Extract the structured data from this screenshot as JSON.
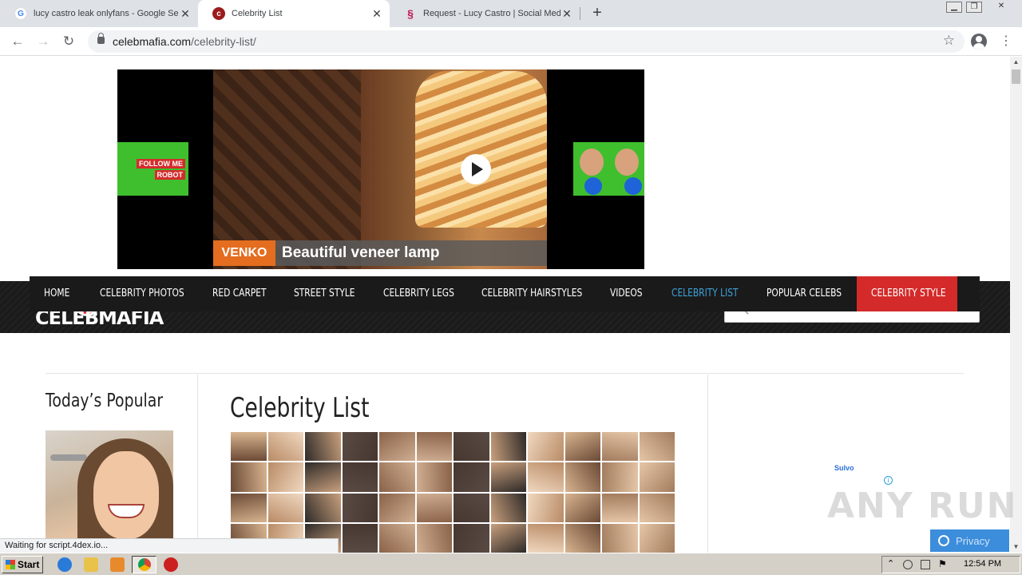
{
  "browser": {
    "tabs": [
      {
        "title": "lucy castro leak onlyfans - Google Se",
        "favicon": "google-icon"
      },
      {
        "title": "Celebrity List",
        "favicon": "celebmafia-icon"
      },
      {
        "title": "Request - Lucy Castro | Social Media",
        "favicon": "social-icon"
      }
    ],
    "url_domain": "celebmafia.com",
    "url_path": "/celebrity-list/",
    "status_text": "Waiting for script.4dex.io..."
  },
  "ad": {
    "brand": "VENKO",
    "caption": "Beautiful veneer lamp",
    "left_thumb_lines": [
      "FOLLOW ME",
      "ROBOT"
    ]
  },
  "site": {
    "logo_text": "CELEBMAFIA",
    "search_placeholder": "Search",
    "nav": [
      {
        "label": "HOME",
        "active": false
      },
      {
        "label": "CELEBRITY PHOTOS",
        "active": false
      },
      {
        "label": "RED CARPET",
        "active": false
      },
      {
        "label": "STREET STYLE",
        "active": false
      },
      {
        "label": "CELEBRITY LEGS",
        "active": false
      },
      {
        "label": "CELEBRITY HAIRSTYLES",
        "active": false
      },
      {
        "label": "VIDEOS",
        "active": false
      },
      {
        "label": "CELEBRITY LIST",
        "active": true
      },
      {
        "label": "POPULAR CELEBS",
        "active": false
      },
      {
        "label": "CELEBRITY STYLE",
        "active": false
      }
    ],
    "sidebar_title": "Today’s Popular",
    "page_title": "Celebrity List",
    "right_ad_label": "Sulvo",
    "privacy_label": "Privacy",
    "accent_red": "#d42a2a",
    "active_blue": "#3ea1d8"
  },
  "watermark": "ANY RUN",
  "taskbar": {
    "start_label": "Start",
    "clock": "12:54 PM"
  }
}
